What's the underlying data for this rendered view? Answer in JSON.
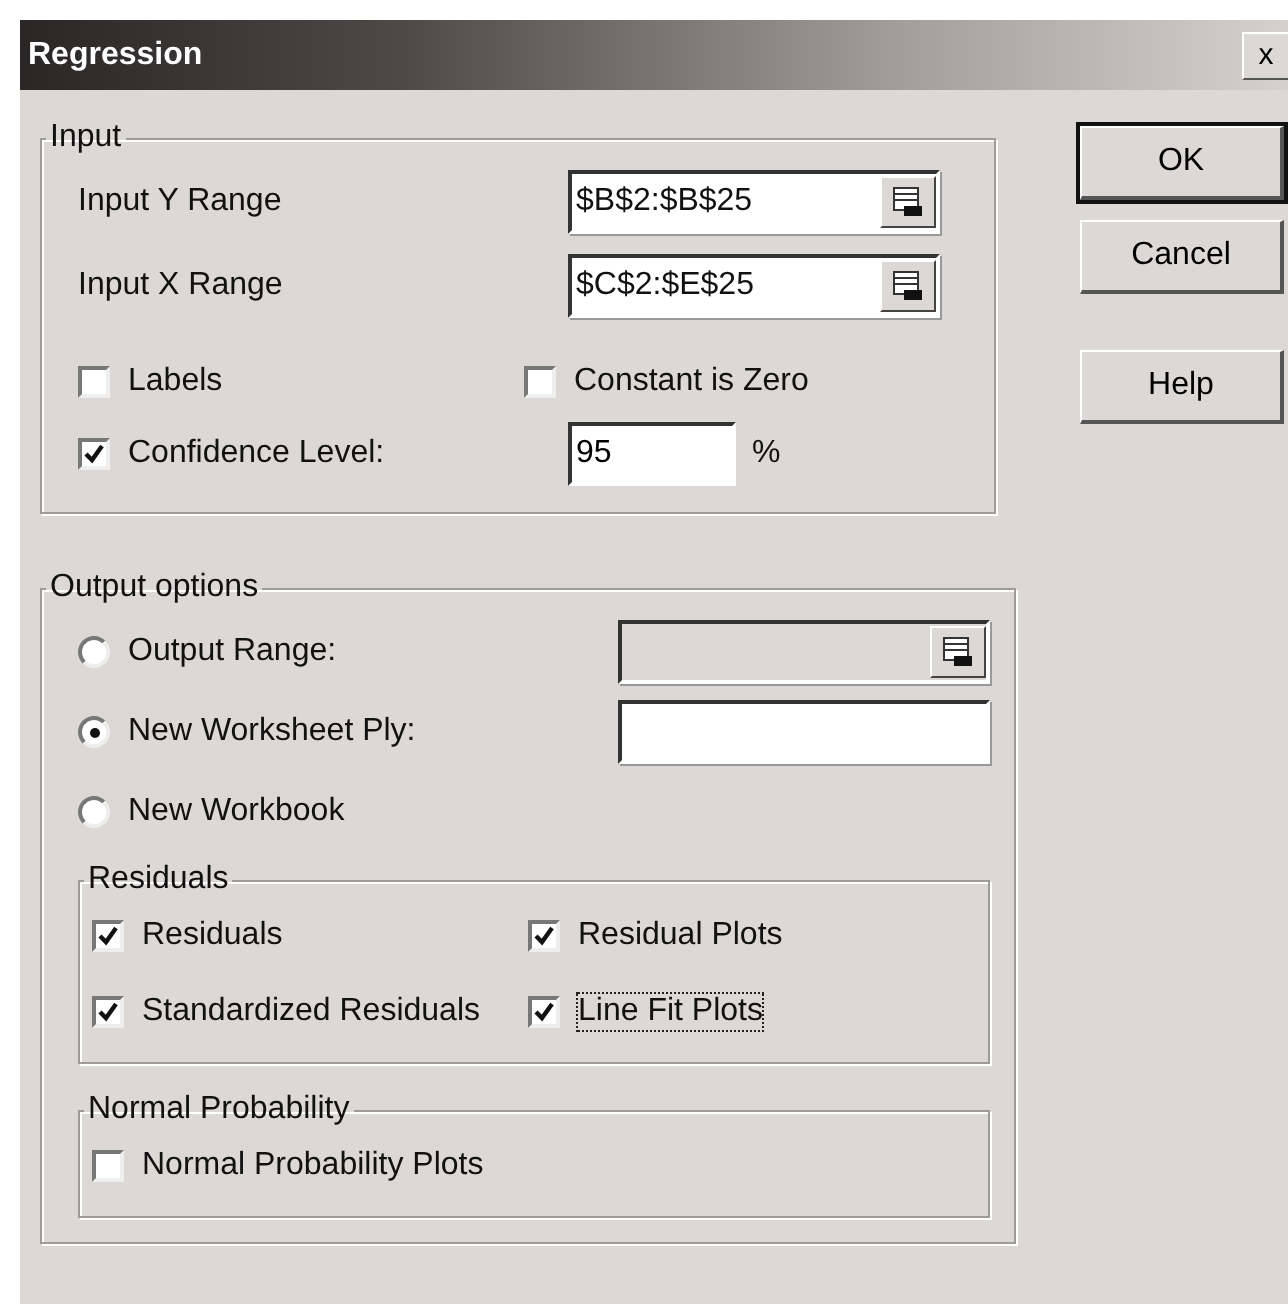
{
  "window": {
    "title": "Regression",
    "close_button": "x"
  },
  "buttons": [
    {
      "label": "OK",
      "default": true
    },
    {
      "label": "Cancel",
      "default": false
    },
    {
      "label": "Help",
      "default": false
    }
  ],
  "input": {
    "title": "Input",
    "ranges": [
      {
        "label": "Input Y Range",
        "value": "$B$2:$B$25"
      },
      {
        "label": "Input X Range",
        "value": "$C$2:$E$25"
      }
    ],
    "options": [
      {
        "label": "Labels",
        "checked": false
      },
      {
        "label": "Constant is Zero",
        "checked": false
      }
    ],
    "confidence": {
      "label": "Confidence Level:",
      "checked": true,
      "value": "95",
      "unit": "%"
    }
  },
  "output": {
    "title": "Output options",
    "destinations": [
      {
        "label": "Output Range:",
        "selected": false,
        "field": {
          "kind": "range",
          "disabled": true
        }
      },
      {
        "label": "New Worksheet Ply:",
        "selected": true,
        "field": {
          "kind": "text",
          "disabled": false
        }
      },
      {
        "label": "New Workbook",
        "selected": false
      }
    ],
    "residuals": {
      "title": "Residuals",
      "options": [
        {
          "label": "Residuals",
          "checked": true,
          "focused": false
        },
        {
          "label": "Residual Plots",
          "checked": true,
          "focused": false
        },
        {
          "label": "Standardized Residuals",
          "checked": true,
          "focused": false
        },
        {
          "label": "Line Fit Plots",
          "checked": true,
          "focused": true
        }
      ]
    },
    "normal_probability": {
      "title": "Normal Probability",
      "options": [
        {
          "label": "Normal Probability Plots",
          "checked": false,
          "focused": false
        }
      ]
    }
  }
}
